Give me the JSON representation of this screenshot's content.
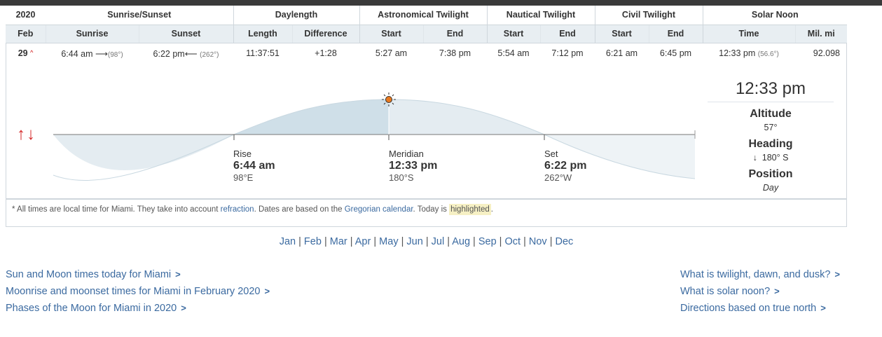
{
  "table": {
    "group_headers": {
      "year": "2020",
      "sunrise_sunset": "Sunrise/Sunset",
      "daylength": "Daylength",
      "astro": "Astronomical Twilight",
      "nautical": "Nautical Twilight",
      "civil": "Civil Twilight",
      "noon": "Solar Noon"
    },
    "sub_headers": [
      "Feb",
      "Sunrise",
      "Sunset",
      "Length",
      "Difference",
      "Start",
      "End",
      "Start",
      "End",
      "Start",
      "End",
      "Time",
      "Mil. mi"
    ],
    "row": {
      "day": "29",
      "sunrise": "6:44 am",
      "sunrise_dir": "(98°)",
      "sunset": "6:22 pm",
      "sunset_dir": "(262°)",
      "length": "11:37:51",
      "difference": "+1:28",
      "astro_start": "5:27 am",
      "astro_end": "7:38 pm",
      "nautical_start": "5:54 am",
      "nautical_end": "7:12 pm",
      "civil_start": "6:21 am",
      "civil_end": "6:45 pm",
      "noon_time": "12:33 pm",
      "noon_alt": "(56.6°)",
      "distance": "92.098"
    }
  },
  "graph": {
    "rise": {
      "label": "Rise",
      "time": "6:44 am",
      "dir": "98°E"
    },
    "meridian": {
      "label": "Meridian",
      "time": "12:33 pm",
      "dir": "180°S"
    },
    "set": {
      "label": "Set",
      "time": "6:22 pm",
      "dir": "262°W"
    }
  },
  "panel": {
    "time": "12:33 pm",
    "altitude_label": "Altitude",
    "altitude": "57°",
    "heading_label": "Heading",
    "heading": "180° S",
    "position_label": "Position",
    "position": "Day"
  },
  "footnote": {
    "p1": "* All times are local time for Miami. They take into account ",
    "refraction": "refraction",
    "p2": ". Dates are based on the ",
    "gregorian": "Gregorian calendar",
    "p3": ". Today is ",
    "highlighted": "highlighted",
    "p4": "."
  },
  "months": [
    "Jan",
    "Feb",
    "Mar",
    "Apr",
    "May",
    "Jun",
    "Jul",
    "Aug",
    "Sep",
    "Oct",
    "Nov",
    "Dec"
  ],
  "links_left": [
    "Sun and Moon times today for Miami",
    "Moonrise and moonset times for Miami in February 2020",
    "Phases of the Moon for Miami in 2020"
  ],
  "links_right": [
    "What is twilight, dawn, and dusk?",
    "What is solar noon?",
    "Directions based on true north"
  ],
  "colors": {
    "link": "#3b6aa0",
    "header_bg": "#e8eef2",
    "sun": "#e8791f",
    "highlight": "#f6f0c4"
  }
}
